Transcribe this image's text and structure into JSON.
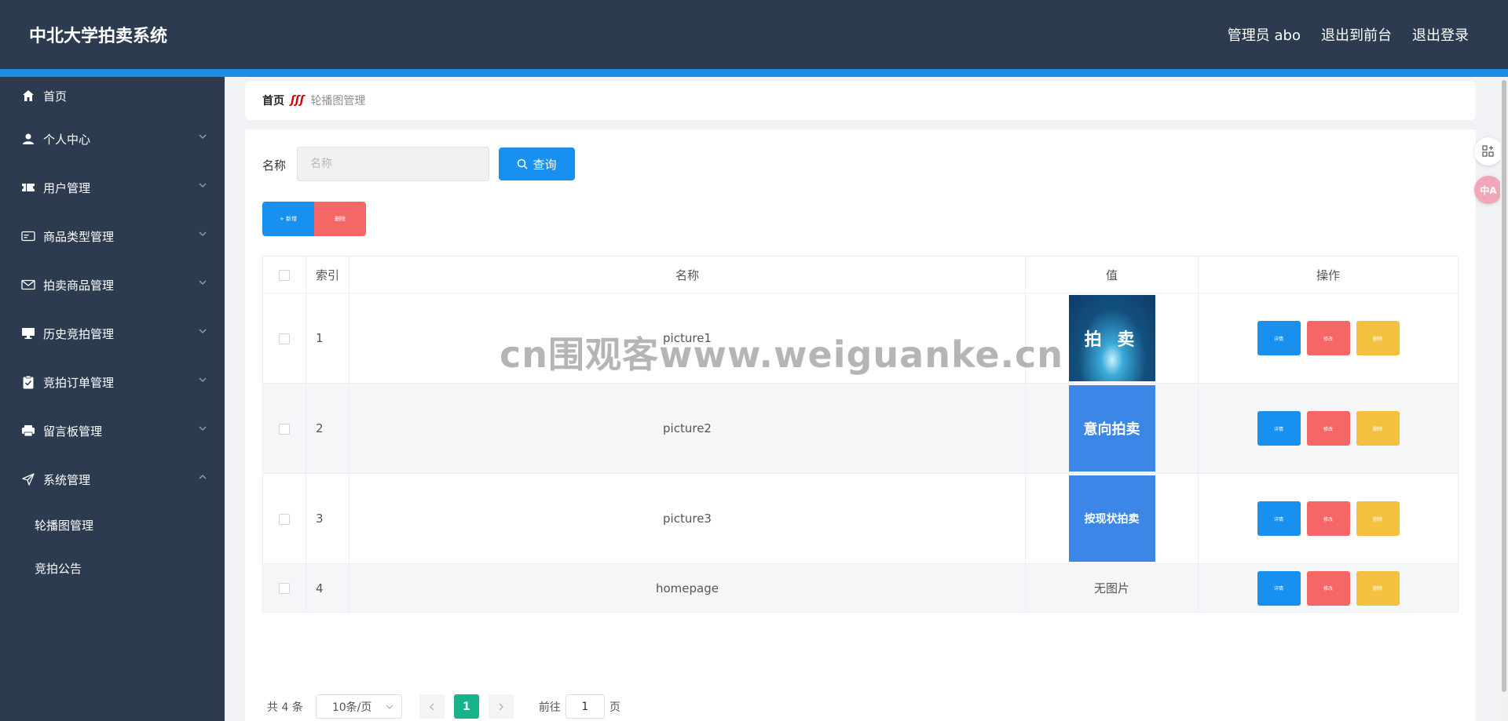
{
  "header": {
    "title": "中北大学拍卖系统",
    "admin": "管理员 abo",
    "front": "退出到前台",
    "logout": "退出登录"
  },
  "sidebar": {
    "items": [
      {
        "label": "首页",
        "icon": "home-icon"
      },
      {
        "label": "个人中心",
        "icon": "user-icon"
      },
      {
        "label": "用户管理",
        "icon": "ticket-icon"
      },
      {
        "label": "商品类型管理",
        "icon": "card-icon"
      },
      {
        "label": "拍卖商品管理",
        "icon": "mail-icon"
      },
      {
        "label": "历史竞拍管理",
        "icon": "monitor-icon"
      },
      {
        "label": "竞拍订单管理",
        "icon": "clipboard-icon"
      },
      {
        "label": "留言板管理",
        "icon": "printer-icon"
      },
      {
        "label": "系统管理",
        "icon": "send-icon"
      }
    ],
    "sub": [
      "轮播图管理",
      "竞拍公告"
    ]
  },
  "breadcrumb": {
    "home": "首页",
    "current": "轮播图管理"
  },
  "search": {
    "label": "名称",
    "placeholder": "名称",
    "button": "查询"
  },
  "actions": {
    "add": "+ 新增",
    "delete": "删除"
  },
  "table": {
    "headers": [
      "索引",
      "名称",
      "值",
      "操作"
    ],
    "rows": [
      {
        "index": "1",
        "name": "picture1",
        "thumb": "拍 卖"
      },
      {
        "index": "2",
        "name": "picture2",
        "thumb": "意向拍卖"
      },
      {
        "index": "3",
        "name": "picture3",
        "thumb": "按现状拍卖"
      },
      {
        "index": "4",
        "name": "homepage",
        "value": "无图片"
      }
    ],
    "ops": {
      "view": "详情",
      "edit": "修改",
      "remove": "删除"
    }
  },
  "pager": {
    "total": "共 4 条",
    "size": "10条/页",
    "page": "1",
    "goto": "前往",
    "goto_value": "1",
    "unit": "页"
  },
  "watermark": "cn围观客www.weiguanke.cn",
  "float": {
    "translate": "中A"
  },
  "colors": {
    "header": "#2c3b50",
    "accent": "#1890ef",
    "danger": "#f56767",
    "warning": "#f3c13f",
    "page_active": "#17b38a"
  }
}
